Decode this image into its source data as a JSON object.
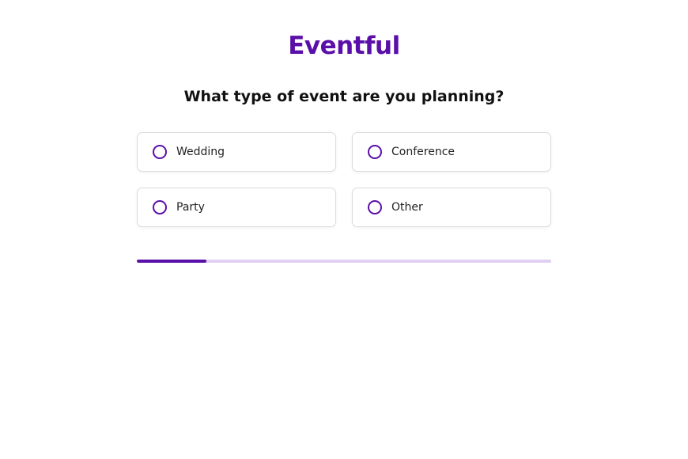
{
  "brand": {
    "name": "Eventful",
    "color": "#5a0fa8"
  },
  "question": "What type of event are you planning?",
  "options": [
    {
      "label": "Wedding",
      "selected": false
    },
    {
      "label": "Conference",
      "selected": false
    },
    {
      "label": "Party",
      "selected": false
    },
    {
      "label": "Other",
      "selected": false
    }
  ],
  "progress": {
    "fraction": 0.167,
    "track_color": "#dfcff0",
    "fill_color": "#5a0fa8"
  }
}
